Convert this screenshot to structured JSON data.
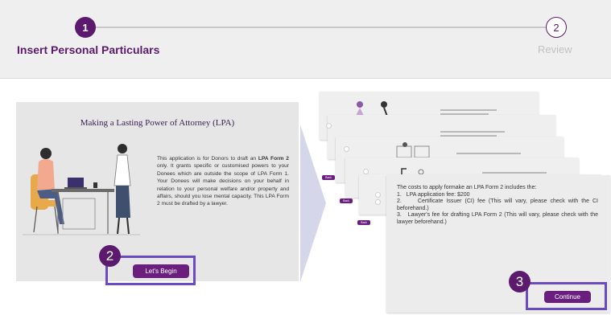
{
  "stepper": {
    "steps": [
      {
        "number": "1",
        "label": "Insert Personal Particulars"
      },
      {
        "number": "2",
        "label": "Review"
      }
    ]
  },
  "intro": {
    "title": "Making a Lasting Power of Attorney (LPA)",
    "text_1": "This application is for Donors to draft an ",
    "text_bold": "LPA Form 2",
    "text_2": " only. It grants specific or customised powers to your Donees which are outside the scope of LPA Form 1. Your Donees will make decisions on your behalf in relation to your personal welfare and/or property and affairs, should you lose mental capacity. This LPA Form 2 must be drafted by a lawyer.",
    "begin_label": "Let's Begin"
  },
  "costs": {
    "intro": "The costs to apply formake an LPA Form 2 includes the:",
    "items": [
      "1.   LPA application fee: $200",
      "2.     Certificate Issuer (CI) fee (This will vary, please check with the CI beforehand.)",
      "3.   Lawyer's fee for drafting LPA Form 2 (This will vary, please check with the lawyer beforehand.)"
    ],
    "continue_label": "Continue"
  },
  "stacked_slides": {
    "back_label": "Back"
  },
  "callouts": {
    "badge_2": "2",
    "badge_3": "3"
  },
  "colors": {
    "brand_purple": "#5b1a6e",
    "button_purple": "#6a1f7e",
    "highlight": "#6a4ac2"
  }
}
